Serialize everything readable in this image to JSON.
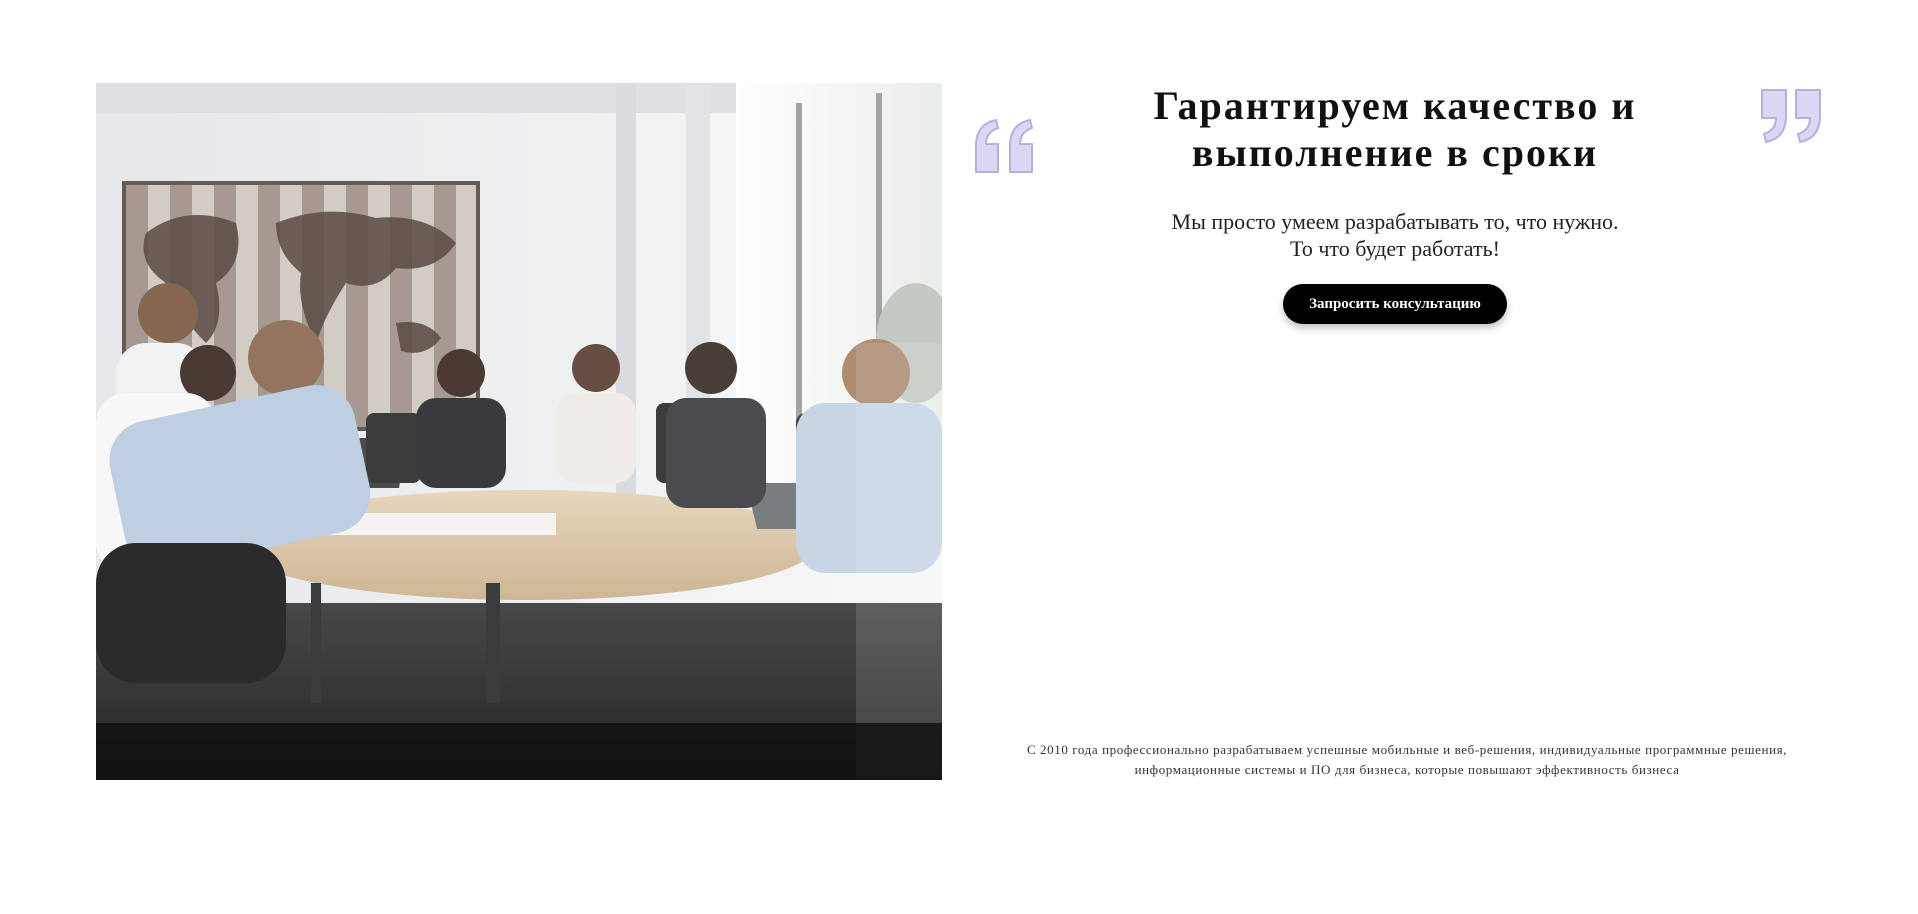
{
  "hero": {
    "image_alt": "Деловая встреча команды за круглым столом",
    "headline_line1": "Гарантируем качество и",
    "headline_line2": "выполнение в сроки",
    "subtext_line1": "Мы просто умеем разрабатывать то, что нужно.",
    "subtext_line2": "То что будет работать!",
    "cta_label": "Запросить консультацию",
    "quote_icon_open": "quote-open-icon",
    "quote_icon_close": "quote-close-icon",
    "quote_color": "#d9d3f0",
    "quote_stroke": "#b9b0dc",
    "cta_background": "#000000",
    "cta_text_color": "#ffffff"
  },
  "footer_note": {
    "line1": "С 2010 года профессионально разрабатываем успешные мобильные и веб-решения, индивидуальные программные решения,",
    "line2": "информационные системы и ПО для бизнеса, которые повышают эффективность бизнеса"
  }
}
